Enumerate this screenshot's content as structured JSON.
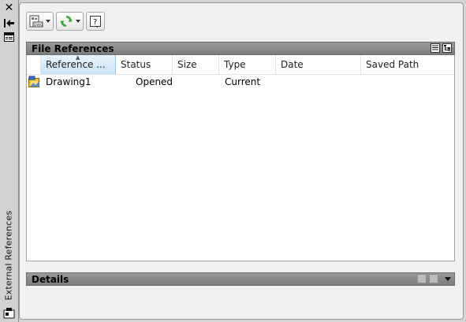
{
  "palette": {
    "title": "External References"
  },
  "toolbar": {
    "attach_icon_label": "DWG"
  },
  "file_references": {
    "title": "File References",
    "columns": [
      "Reference ...",
      "Status",
      "Size",
      "Type",
      "Date",
      "Saved Path"
    ],
    "rows": [
      {
        "name": "Drawing1",
        "status": "Opened",
        "size": "",
        "type": "Current",
        "date": "",
        "saved_path": ""
      }
    ]
  },
  "details": {
    "title": "Details"
  },
  "colors": {
    "header_bg": "#8a8a8a",
    "selected_column": "#c9e4f6",
    "refresh_green": "#3aa635"
  }
}
